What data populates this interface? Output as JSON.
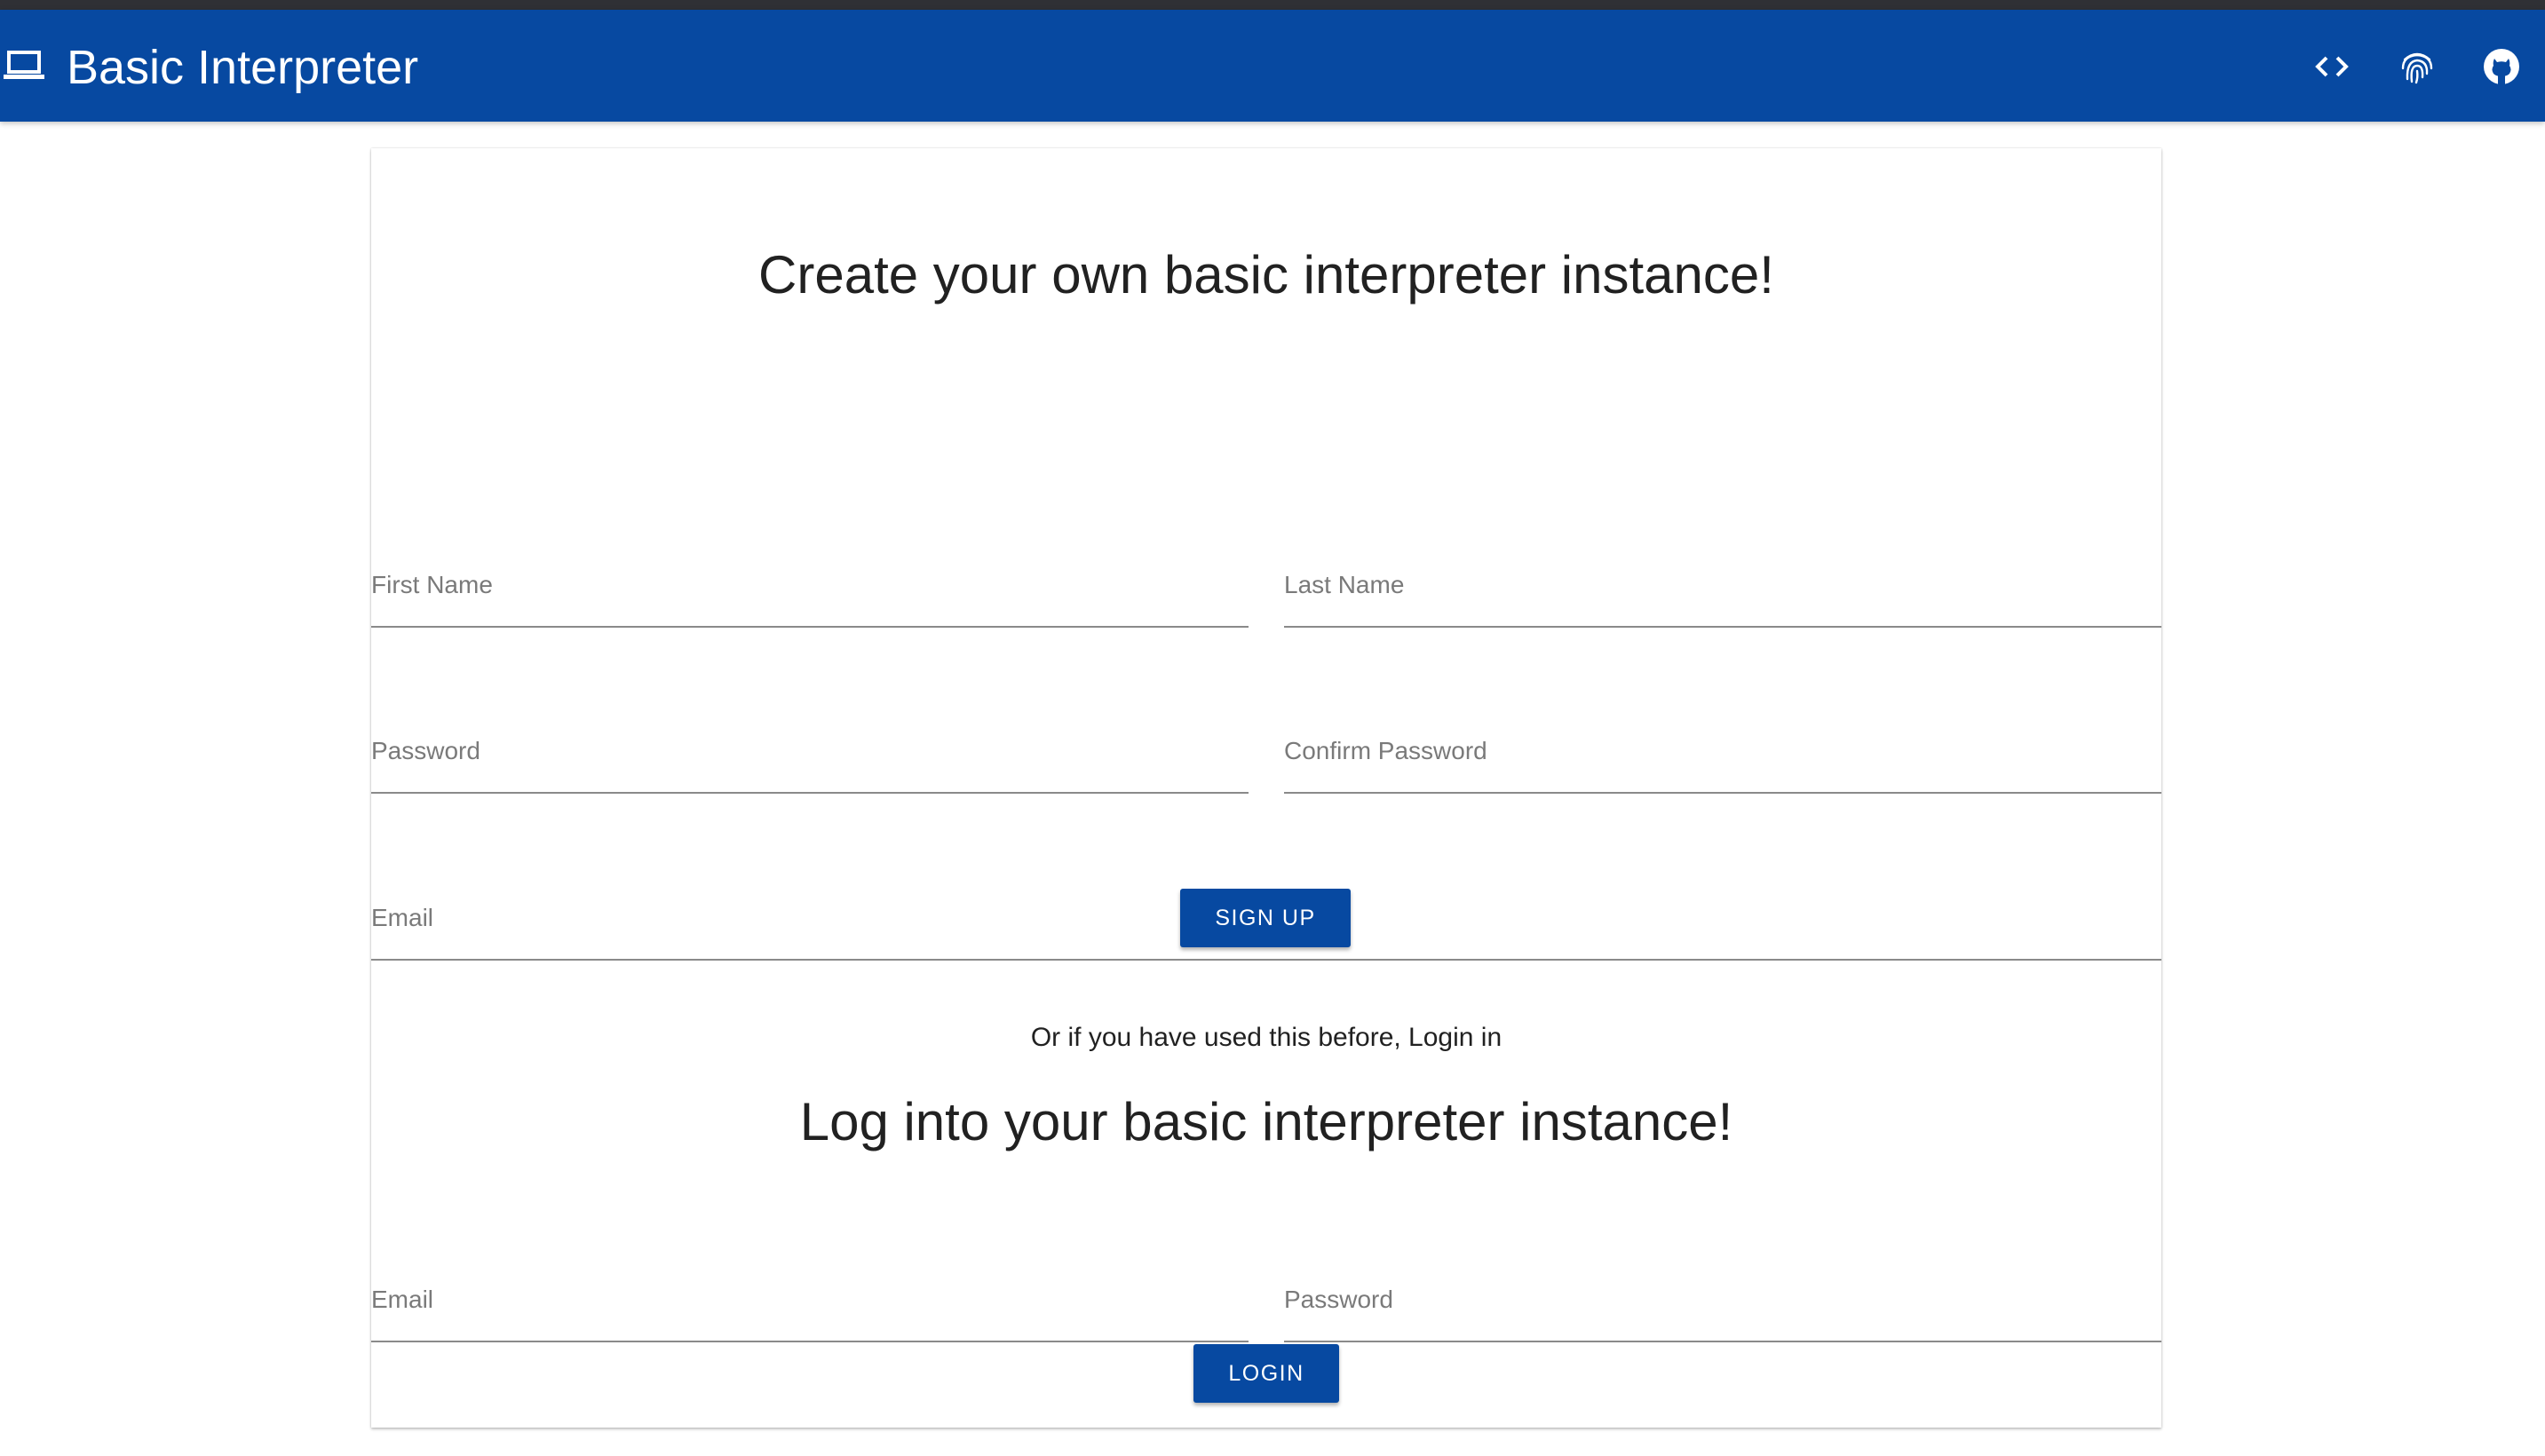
{
  "appbar": {
    "title": "Basic Interpreter",
    "brand_icon": "laptop-icon",
    "actions": [
      {
        "icon": "code-icon"
      },
      {
        "icon": "fingerprint-icon"
      },
      {
        "icon": "github-icon"
      }
    ],
    "color": "#0749a1"
  },
  "signup": {
    "heading": "Create your own basic interpreter instance!",
    "first_name_label": "First Name",
    "last_name_label": "Last Name",
    "password_label": "Password",
    "confirm_password_label": "Confirm Password",
    "email_label": "Email",
    "button_label": "SIGN UP"
  },
  "divider_text": "Or if you have used this before, Login in",
  "login": {
    "heading": "Log into your basic interpreter instance!",
    "email_label": "Email",
    "password_label": "Password",
    "button_label": "LOGIN"
  }
}
